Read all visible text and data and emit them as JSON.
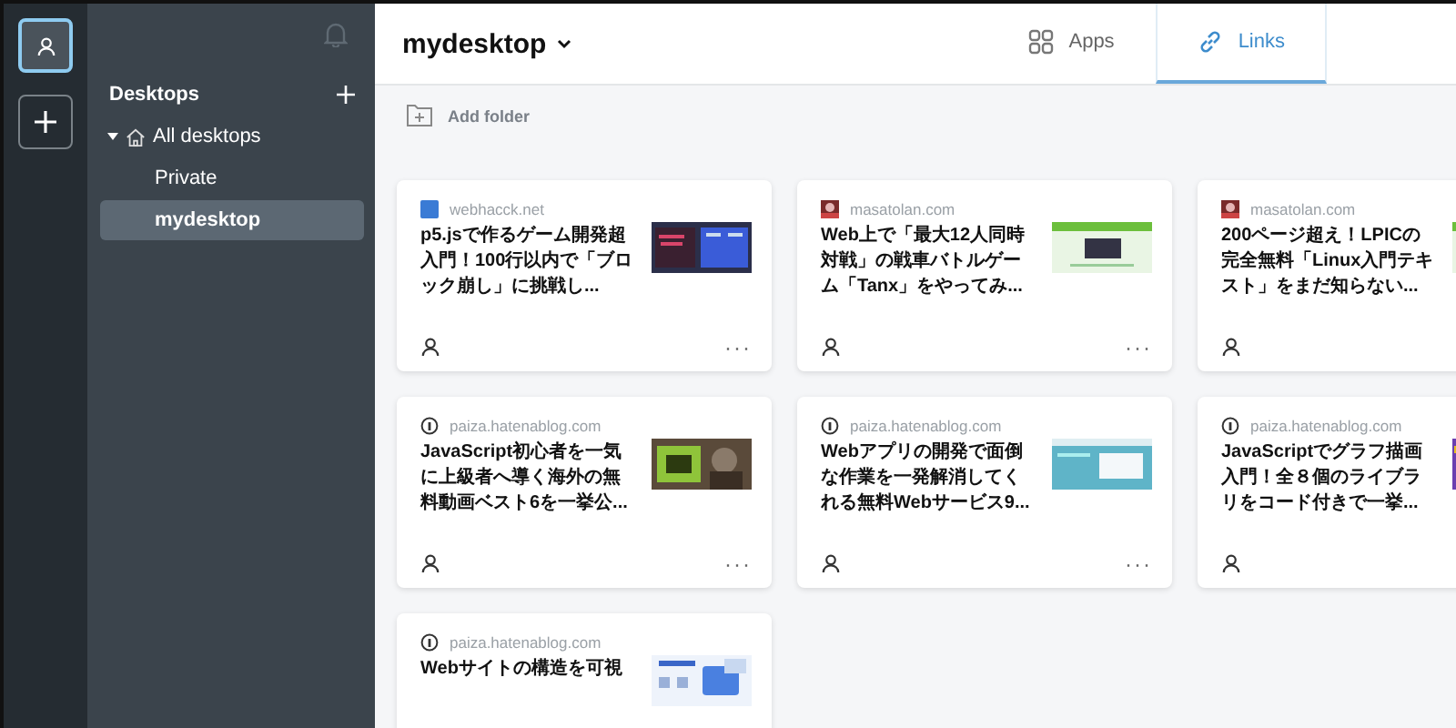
{
  "rail": {
    "buttons": [
      {
        "kind": "user",
        "selected": true
      },
      {
        "kind": "add",
        "selected": false
      }
    ]
  },
  "sidebar": {
    "heading": "Desktops",
    "tree": [
      {
        "label": "All desktops",
        "expanded": true,
        "selected": false,
        "children": [
          {
            "label": "Private",
            "selected": false
          },
          {
            "label": "mydesktop",
            "selected": true
          }
        ]
      }
    ]
  },
  "header": {
    "title": "mydesktop",
    "tabs": [
      {
        "label": "Apps",
        "kind": "apps",
        "selected": false
      },
      {
        "label": "Links",
        "kind": "links",
        "selected": true
      }
    ]
  },
  "toolbar": {
    "add_folder": "Add folder"
  },
  "cards": [
    {
      "domain": "webhacck.net",
      "favicon": {
        "kind": "square"
      },
      "title": "p5.jsで作るゲーム開発超入門！100行以内で「ブロック崩し」に挑戦し...",
      "more": "···",
      "owner": true
    },
    {
      "domain": "masatolan.com",
      "title": "Web上で「最大12人同時対戦」の戦車バトルゲーム「Tanx」をやってみ...",
      "more": "···",
      "owner": true
    },
    {
      "domain": "masatolan.com",
      "title": "200ページ超え！LPICの完全無料「Linux入門テキスト」をまだ知らない...",
      "owner": true
    },
    {
      "domain": "paiza.hatenablog.com",
      "favicon": {
        "kind": "circle"
      },
      "title": "JavaScript初心者を一気に上級者へ導く海外の無料動画ベスト6を一挙公...",
      "more": "···",
      "owner": true
    },
    {
      "domain": "paiza.hatenablog.com",
      "favicon": {
        "kind": "circle"
      },
      "title": "Webアプリの開発で面倒な作業を一発解消してくれる無料Webサービス9...",
      "more": "···",
      "owner": true
    },
    {
      "domain": "paiza.hatenablog.com",
      "favicon": {
        "kind": "circle"
      },
      "title": "JavaScriptでグラフ描画入門！全８個のライブラリをコード付きで一挙...",
      "owner": true
    },
    {
      "domain": "paiza.hatenablog.com",
      "favicon": {
        "kind": "circle"
      },
      "title": "Webサイトの構造を可視"
    }
  ]
}
